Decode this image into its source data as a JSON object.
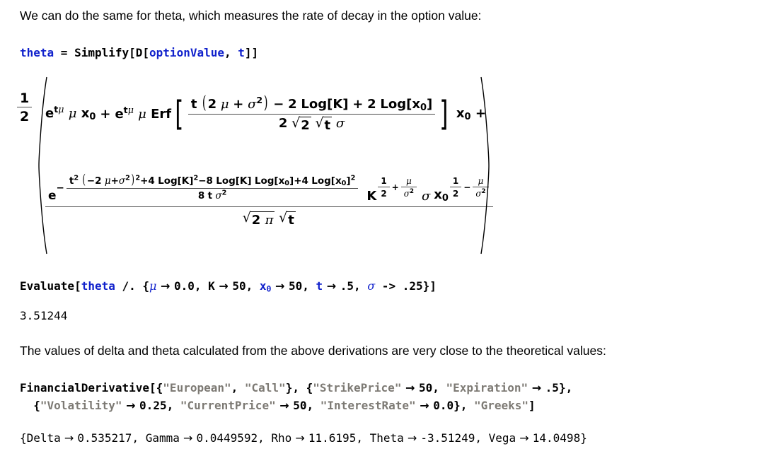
{
  "document": {
    "type": "mathematica-notebook",
    "background": "#ffffff",
    "colors": {
      "text": "#000000",
      "symbol": "#1122cc",
      "string": "#7d7a74",
      "fraction_rule": "#4a4a4a"
    }
  },
  "cells": [
    {
      "id": "intro-text",
      "kind": "text",
      "content": "We can do the same for theta, which measures the rate of decay in the option value:"
    },
    {
      "id": "theta-input",
      "kind": "input",
      "tokens": [
        {
          "t": "theta",
          "c": "symbol"
        },
        {
          "t": " = ",
          "c": "plain"
        },
        {
          "t": "Simplify[D[",
          "c": "plain"
        },
        {
          "t": "optionValue",
          "c": "symbol"
        },
        {
          "t": ", ",
          "c": "plain"
        },
        {
          "t": "t",
          "c": "symbol"
        },
        {
          "t": "]]",
          "c": "plain"
        }
      ],
      "plain": "theta = Simplify[D[optionValue, t]]"
    },
    {
      "id": "theta-output-formula",
      "kind": "math-output",
      "latex_like": "1/2 ( e^(t mu) mu x_0 + e^(t mu) mu Erf[ (t (2 mu + sigma^2) - 2 Log[K] + 2 Log[x_0]) / (2 sqrt(2) sqrt(t) sigma) ] x_0 + e^(-(t^2 (-2 mu + sigma^2)^2 + 4 Log[K]^2 - 8 Log[K] Log[x_0] + 4 Log[x_0]^2)/(8 t sigma^2)) K^(1/2 + mu/sigma^2) sigma x_0^(1/2 - mu/sigma^2) / (sqrt(2 pi) sqrt(t)) )",
      "parts": {
        "leading_fraction": {
          "num": "1",
          "den": "2"
        },
        "term1": "e^{tμ} μ x₀",
        "term2_prefix": "e^{tμ} μ Erf",
        "erf_numerator": "t (2 μ + σ²) − 2 Log[K] + 2 Log[x₀]",
        "erf_denominator": "2 √2 √t σ",
        "term2_suffix": "x₀ +",
        "exp_numerator": "t² (−2 μ+σ²)²+4 Log[K]²−8 Log[K] Log[x₀]+4 Log[x₀]²",
        "exp_denominator": "8 t σ²",
        "tail_factors": "K^{1/2+μ/σ²} σ x₀^{1/2−μ/σ²}",
        "bottom_denominator": "√(2 π) √t"
      }
    },
    {
      "id": "evaluate-input",
      "kind": "input",
      "plain": "Evaluate[theta /. {μ → 0.0, K → 50, x₀ → 50, t → .5, σ -> .25}]",
      "substitutions": [
        {
          "variable": "μ",
          "arrow": "→",
          "value": "0.0"
        },
        {
          "variable": "K",
          "arrow": "→",
          "value": "50"
        },
        {
          "variable": "x₀",
          "arrow": "→",
          "value": "50"
        },
        {
          "variable": "t",
          "arrow": "→",
          "value": ".5"
        },
        {
          "variable": "σ",
          "arrow": "->",
          "value": ".25"
        }
      ]
    },
    {
      "id": "evaluate-output",
      "kind": "output",
      "value": "3.51244"
    },
    {
      "id": "closing-text",
      "kind": "text",
      "content": "The values of delta and theta calculated from the above derivations are very close to the theoretical values:"
    },
    {
      "id": "financial-derivative-input",
      "kind": "input",
      "line1_plain": "FinancialDerivative[{\"European\", \"Call\"}, {\"StrikePrice\" → 50, \"Expiration\" → .5},",
      "line2_plain": "  {\"Volatility\" → 0.25, \"CurrentPrice\" → 50, \"InterestRate\" → 0.0}, \"Greeks\"]",
      "function_name": "FinancialDerivative",
      "instrument": [
        "\"European\", \"Call\""
      ],
      "params_line1": [
        {
          "key": "\"StrikePrice\"",
          "value": "50"
        },
        {
          "key": "\"Expiration\"",
          "value": ".5"
        }
      ],
      "params_line2": [
        {
          "key": "\"Volatility\"",
          "value": "0.25"
        },
        {
          "key": "\"CurrentPrice\"",
          "value": "50"
        },
        {
          "key": "\"InterestRate\"",
          "value": "0.0"
        }
      ],
      "request": "\"Greeks\""
    },
    {
      "id": "greeks-output",
      "kind": "output",
      "plain": "{Delta → 0.535217, Gamma → 0.0449592, Rho → 11.6195, Theta → -3.51249, Vega → 14.0498}",
      "results": [
        {
          "name": "Delta",
          "value": "0.535217"
        },
        {
          "name": "Gamma",
          "value": "0.0449592"
        },
        {
          "name": "Rho",
          "value": "11.6195"
        },
        {
          "name": "Theta",
          "value": "-3.51249"
        },
        {
          "name": "Vega",
          "value": "14.0498"
        }
      ]
    }
  ],
  "glyphs": {
    "mu": "μ",
    "sigma": "σ",
    "pi": "π",
    "rule_arrow": "→",
    "ascii_rule_arrow": "->",
    "minus": "−",
    "radical": "√",
    "sub_zero": "₀"
  }
}
